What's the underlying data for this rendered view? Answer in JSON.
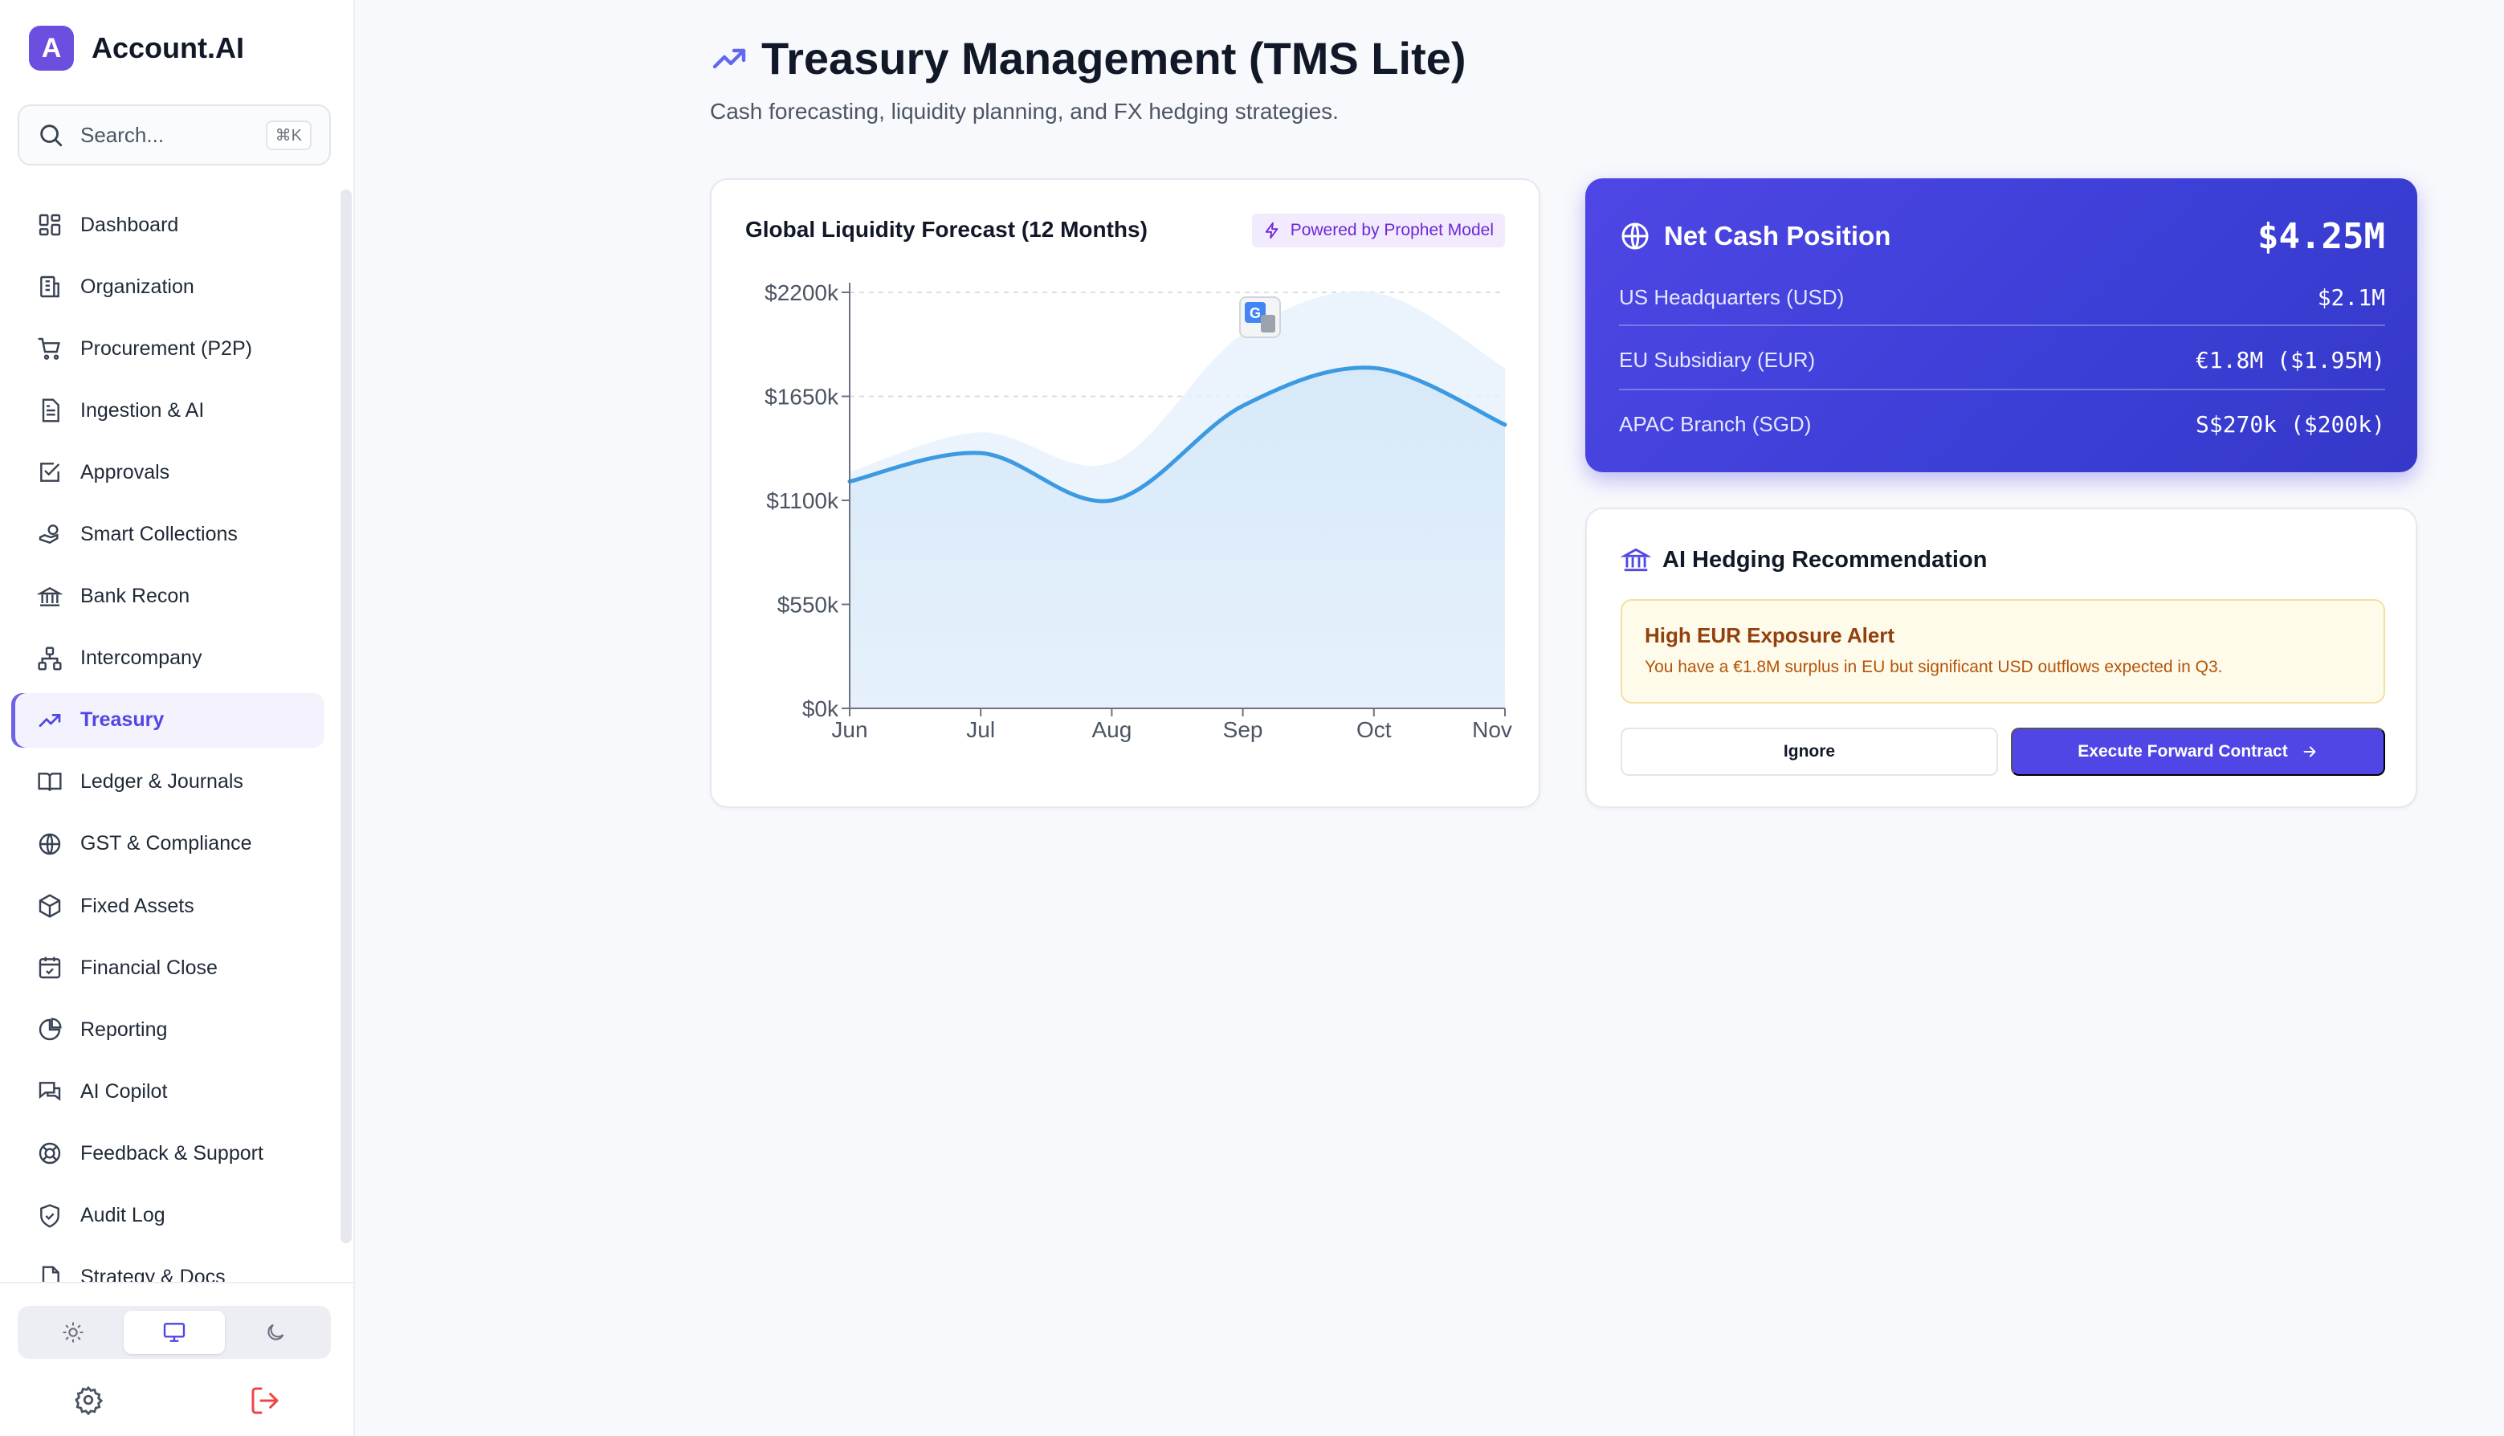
{
  "brand": {
    "logo_letter": "A",
    "name": "Account.AI"
  },
  "search": {
    "placeholder": "Search...",
    "shortcut": "⌘K"
  },
  "sidebar": {
    "items": [
      {
        "label": "Dashboard",
        "icon": "dashboard-icon"
      },
      {
        "label": "Organization",
        "icon": "building-icon"
      },
      {
        "label": "Procurement (P2P)",
        "icon": "cart-icon"
      },
      {
        "label": "Ingestion & AI",
        "icon": "document-icon"
      },
      {
        "label": "Approvals",
        "icon": "check-square-icon"
      },
      {
        "label": "Smart Collections",
        "icon": "hand-coin-icon"
      },
      {
        "label": "Bank Recon",
        "icon": "bank-icon"
      },
      {
        "label": "Intercompany",
        "icon": "network-icon"
      },
      {
        "label": "Treasury",
        "icon": "trending-up-icon",
        "active": true
      },
      {
        "label": "Ledger & Journals",
        "icon": "book-icon"
      },
      {
        "label": "GST & Compliance",
        "icon": "globe-icon"
      },
      {
        "label": "Fixed Assets",
        "icon": "box-icon"
      },
      {
        "label": "Financial Close",
        "icon": "calendar-check-icon"
      },
      {
        "label": "Reporting",
        "icon": "pie-chart-icon"
      },
      {
        "label": "AI Copilot",
        "icon": "chat-icon"
      },
      {
        "label": "Feedback & Support",
        "icon": "lifebuoy-icon"
      },
      {
        "label": "Audit Log",
        "icon": "shield-check-icon"
      },
      {
        "label": "Strategy & Docs",
        "icon": "file-icon"
      }
    ],
    "theme_options": [
      "sun-icon",
      "monitor-icon",
      "moon-icon"
    ],
    "theme_selected": "monitor-icon"
  },
  "page": {
    "title": "Treasury Management (TMS Lite)",
    "subtitle": "Cash forecasting, liquidity planning, and FX hedging strategies."
  },
  "forecast": {
    "title": "Global Liquidity Forecast (12 Months)",
    "badge": "Powered by Prophet Model"
  },
  "chart_data": {
    "type": "area",
    "title": "Global Liquidity Forecast (12 Months)",
    "categories": [
      "Jun",
      "Jul",
      "Aug",
      "Sep",
      "Oct",
      "Nov"
    ],
    "y_ticks": [
      "$0k",
      "$550k",
      "$1100k",
      "$1650k",
      "$2200k"
    ],
    "ylim": [
      0,
      2200
    ],
    "grid": true,
    "series": [
      {
        "name": "",
        "kind": "line",
        "values": [
          1200,
          1350,
          1100,
          1600,
          1800,
          1500
        ]
      },
      {
        "name": "",
        "kind": "band-upper",
        "values": [
          1250,
          1460,
          1300,
          1980,
          2200,
          1800
        ]
      }
    ],
    "colors": {
      "line": "#3b9ae1",
      "area": "#d6e8f8",
      "band": "#e6f1fc"
    }
  },
  "cash": {
    "title": "Net Cash Position",
    "total": "$4.25M",
    "rows": [
      {
        "label": "US Headquarters (USD)",
        "value": "$2.1M"
      },
      {
        "label": "EU Subsidiary (EUR)",
        "value": "€1.8M ($1.95M)"
      },
      {
        "label": "APAC Branch (SGD)",
        "value": "S$270k ($200k)"
      }
    ]
  },
  "hedging": {
    "title": "AI Hedging Recommendation",
    "alert_title": "High EUR Exposure Alert",
    "alert_text": "You have a €1.8M surplus in EU but significant USD outflows expected in Q3.",
    "ignore_label": "Ignore",
    "execute_label": "Execute Forward Contract"
  }
}
